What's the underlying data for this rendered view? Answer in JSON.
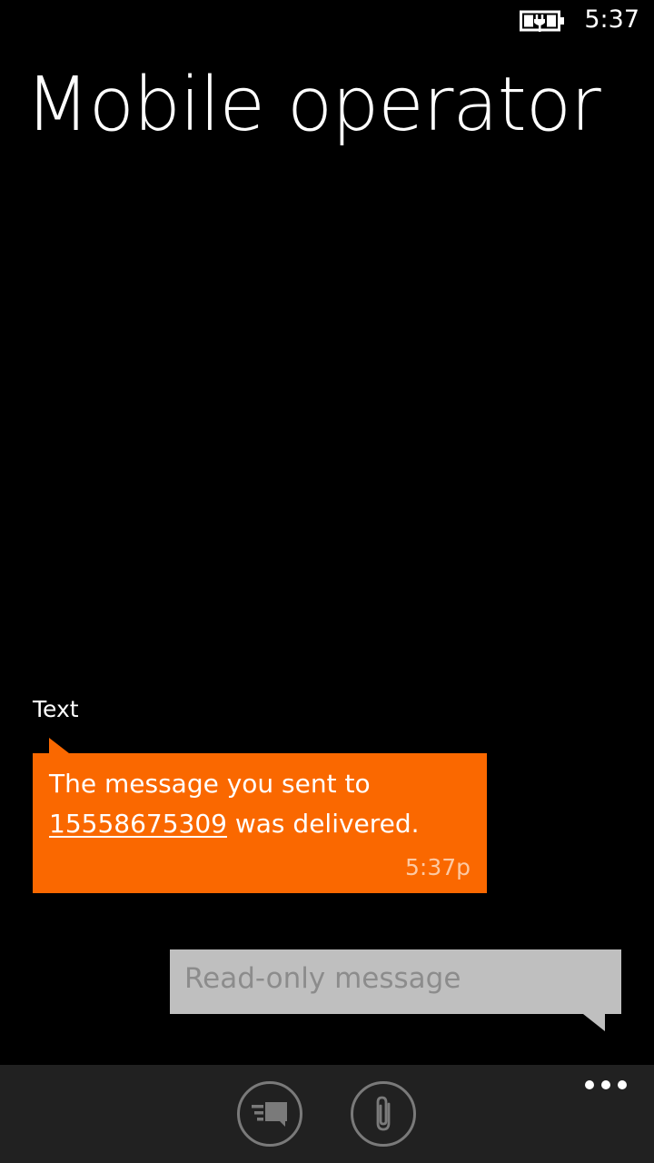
{
  "status_bar": {
    "time": "5:37",
    "battery_icon": "battery-charging-icon"
  },
  "page": {
    "title": "Mobile operator"
  },
  "conversation": {
    "channel_label": "Text",
    "messages": [
      {
        "direction": "incoming",
        "text_before_link": "The message you sent to ",
        "link_text": "15558675309",
        "text_after_link": " was delivered.",
        "time": "5:37p"
      }
    ]
  },
  "composer": {
    "placeholder": "Read-only message"
  },
  "app_bar": {
    "buttons": [
      {
        "icon": "send-icon"
      },
      {
        "icon": "attach-icon"
      }
    ],
    "more_icon": "more-ellipsis-icon"
  },
  "colors": {
    "accent": "#fa6800",
    "background": "#000000",
    "app_bar": "#212121",
    "composer": "#bfbfbf",
    "composer_text": "#8c8c8c"
  }
}
